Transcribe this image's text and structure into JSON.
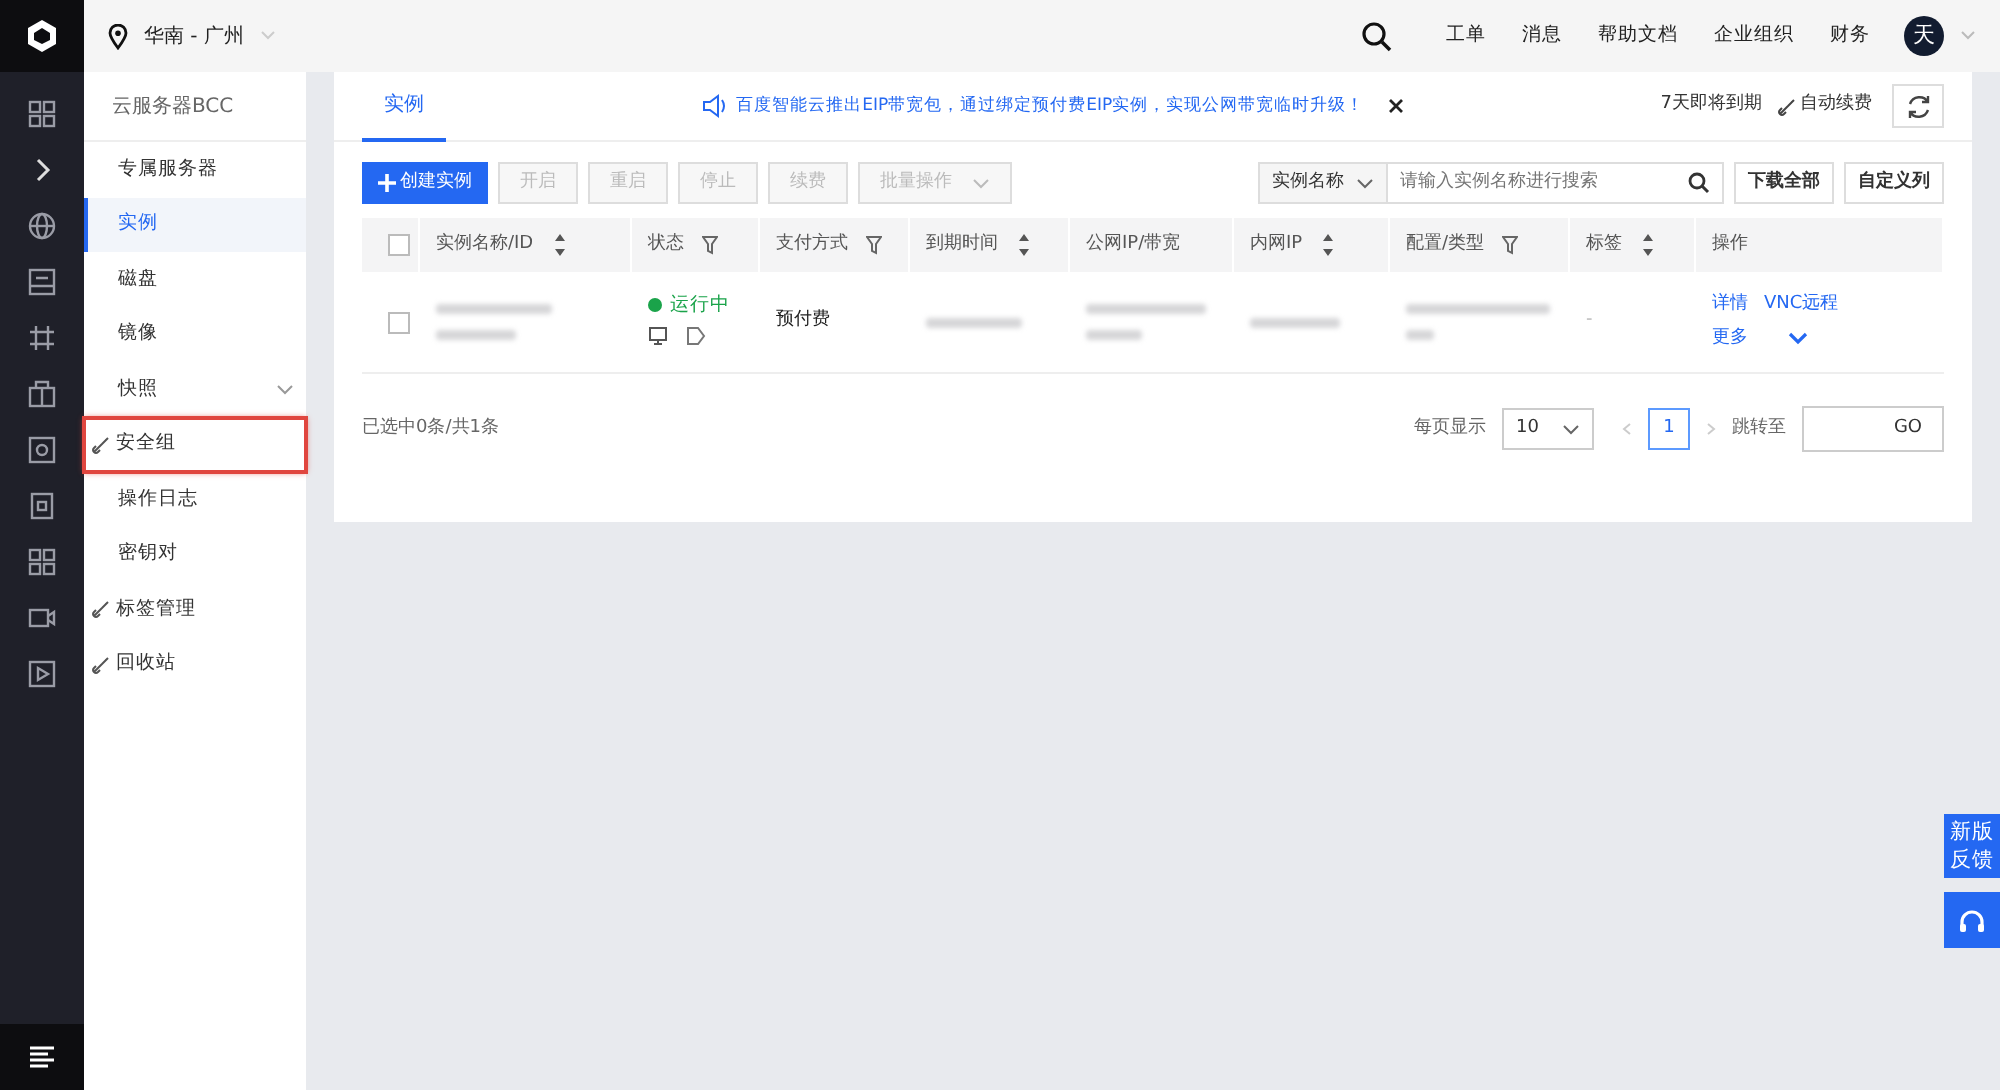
{
  "header": {
    "region": "华南 - 广州",
    "links": [
      "工单",
      "消息",
      "帮助文档",
      "企业组织",
      "财务"
    ],
    "avatar": "天"
  },
  "rail": {
    "items": [
      {
        "kind": "grid"
      },
      {
        "kind": "chevron"
      },
      {
        "kind": "globe"
      },
      {
        "kind": "monitor"
      },
      {
        "kind": "network"
      },
      {
        "kind": "box"
      },
      {
        "kind": "disk"
      },
      {
        "kind": "chip"
      },
      {
        "kind": "grid"
      },
      {
        "kind": "camera"
      },
      {
        "kind": "play"
      }
    ]
  },
  "sidebar": {
    "title": "云服务器BCC",
    "items": [
      {
        "label": "专属服务器",
        "selected": false,
        "link": false,
        "expandable": false,
        "highlighted": false
      },
      {
        "label": "实例",
        "selected": true,
        "link": false,
        "expandable": false,
        "highlighted": false
      },
      {
        "label": "磁盘",
        "selected": false,
        "link": false,
        "expandable": false,
        "highlighted": false
      },
      {
        "label": "镜像",
        "selected": false,
        "link": false,
        "expandable": false,
        "highlighted": false
      },
      {
        "label": "快照",
        "selected": false,
        "link": false,
        "expandable": true,
        "highlighted": false
      },
      {
        "label": "安全组",
        "selected": false,
        "link": true,
        "expandable": false,
        "highlighted": true
      },
      {
        "label": "操作日志",
        "selected": false,
        "link": false,
        "expandable": false,
        "highlighted": false
      },
      {
        "label": "密钥对",
        "selected": false,
        "link": false,
        "expandable": false,
        "highlighted": false
      },
      {
        "label": "标签管理",
        "selected": false,
        "link": true,
        "expandable": false,
        "highlighted": false
      },
      {
        "label": "回收站",
        "selected": false,
        "link": true,
        "expandable": false,
        "highlighted": false
      }
    ]
  },
  "tabs": [
    {
      "label": "实例",
      "selected": true
    }
  ],
  "notice": "百度智能云推出EIP带宽包，通过绑定预付费EIP实例，实现公网带宽临时升级！",
  "expiring": "7天即将到期",
  "auto_renew": "自动续费",
  "toolbar": {
    "create": "创建实例",
    "buttons": [
      {
        "label": "开启",
        "disabled": true
      },
      {
        "label": "重启",
        "disabled": true
      },
      {
        "label": "停止",
        "disabled": true
      },
      {
        "label": "续费",
        "disabled": true
      },
      {
        "label": "批量操作",
        "disabled": true
      }
    ]
  },
  "search": {
    "filter": "实例名称",
    "placeholder": "请输入实例名称进行搜索"
  },
  "actions": [
    "下载全部",
    "自定义列"
  ],
  "table": {
    "select_all": {
      "checked": false
    },
    "columns": [
      {
        "label": "实例名称/ID"
      },
      {
        "label": "状态"
      },
      {
        "label": "支付方式"
      },
      {
        "label": "到期时间"
      },
      {
        "label": "公网IP/带宽"
      },
      {
        "label": "内网IP"
      },
      {
        "label": "配置/类型"
      },
      {
        "label": "标签"
      },
      {
        "label": "操作"
      }
    ],
    "rows": [
      {
        "checked": false,
        "status": "运行中",
        "payment": "预付费",
        "tag": "-",
        "ops": [
          "详情",
          "VNC远程",
          "更多"
        ]
      }
    ]
  },
  "footer": {
    "selection": "已选中0条/共1条",
    "per_page_label": "每页显示",
    "per_page": "10",
    "page": "1",
    "jump": "跳转至",
    "go": "GO"
  },
  "feedback": {
    "label": "新版反馈"
  }
}
